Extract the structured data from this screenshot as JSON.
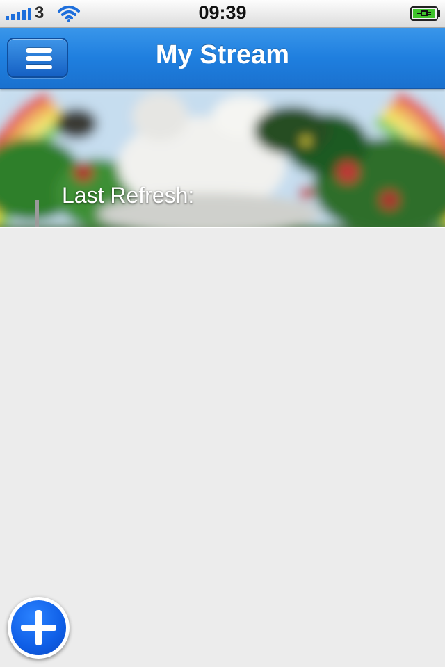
{
  "status_bar": {
    "carrier": "3",
    "time": "09:39",
    "signal_icon": "cellular-signal-icon",
    "wifi_icon": "wifi-icon",
    "battery_icon": "battery-charging-icon"
  },
  "nav_bar": {
    "title": "My Stream",
    "menu_icon": "hamburger-menu-icon"
  },
  "header": {
    "last_refresh_label": "Last Refresh:"
  },
  "fab": {
    "icon": "plus-icon"
  },
  "colors": {
    "nav_blue": "#1f7fdf",
    "fab_blue": "#0f5ee6",
    "background": "#ececec"
  }
}
